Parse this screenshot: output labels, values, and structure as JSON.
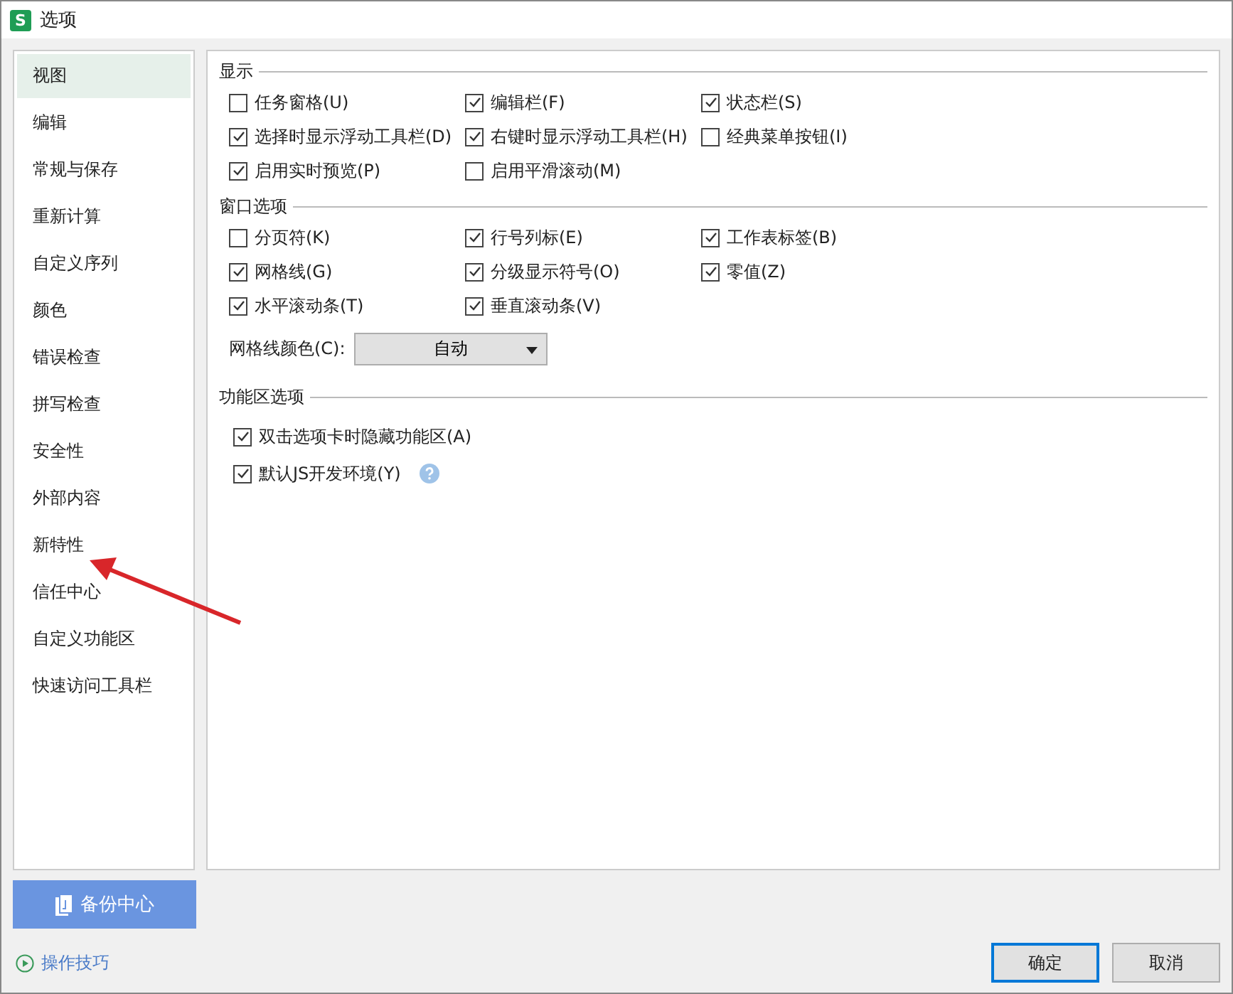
{
  "window": {
    "title": "选项",
    "app_icon": "S"
  },
  "sidebar": {
    "items": [
      {
        "label": "视图",
        "selected": true
      },
      {
        "label": "编辑",
        "selected": false
      },
      {
        "label": "常规与保存",
        "selected": false
      },
      {
        "label": "重新计算",
        "selected": false
      },
      {
        "label": "自定义序列",
        "selected": false
      },
      {
        "label": "颜色",
        "selected": false
      },
      {
        "label": "错误检查",
        "selected": false
      },
      {
        "label": "拼写检查",
        "selected": false
      },
      {
        "label": "安全性",
        "selected": false
      },
      {
        "label": "外部内容",
        "selected": false
      },
      {
        "label": "新特性",
        "selected": false
      },
      {
        "label": "信任中心",
        "selected": false
      },
      {
        "label": "自定义功能区",
        "selected": false
      },
      {
        "label": "快速访问工具栏",
        "selected": false
      }
    ]
  },
  "sections": [
    {
      "title": "显示",
      "kind": "grid",
      "options": [
        {
          "label": "任务窗格(U)",
          "checked": false
        },
        {
          "label": "编辑栏(F)",
          "checked": true
        },
        {
          "label": "状态栏(S)",
          "checked": true
        },
        {
          "label": "选择时显示浮动工具栏(D)",
          "checked": true
        },
        {
          "label": "右键时显示浮动工具栏(H)",
          "checked": true
        },
        {
          "label": "经典菜单按钮(I)",
          "checked": false
        },
        {
          "label": "启用实时预览(P)",
          "checked": true
        },
        {
          "label": "启用平滑滚动(M)",
          "checked": false
        }
      ]
    },
    {
      "title": "窗口选项",
      "kind": "grid",
      "options": [
        {
          "label": "分页符(K)",
          "checked": false
        },
        {
          "label": "行号列标(E)",
          "checked": true
        },
        {
          "label": "工作表标签(B)",
          "checked": true
        },
        {
          "label": "网格线(G)",
          "checked": true
        },
        {
          "label": "分级显示符号(O)",
          "checked": true
        },
        {
          "label": "零值(Z)",
          "checked": true
        },
        {
          "label": "水平滚动条(T)",
          "checked": true
        },
        {
          "label": "垂直滚动条(V)",
          "checked": true
        }
      ],
      "dropdown": {
        "label": "网格线颜色(C):",
        "value": "自动"
      }
    },
    {
      "title": "功能区选项",
      "kind": "list",
      "options": [
        {
          "label": "双击选项卡时隐藏功能区(A)",
          "checked": true,
          "help": false
        },
        {
          "label": "默认JS开发环境(Y)",
          "checked": true,
          "help": true
        }
      ]
    }
  ],
  "backup_button": "备份中心",
  "tips_link": "操作技巧",
  "buttons": [
    {
      "label": "确定",
      "selected": true
    },
    {
      "label": "取消",
      "selected": false
    }
  ]
}
